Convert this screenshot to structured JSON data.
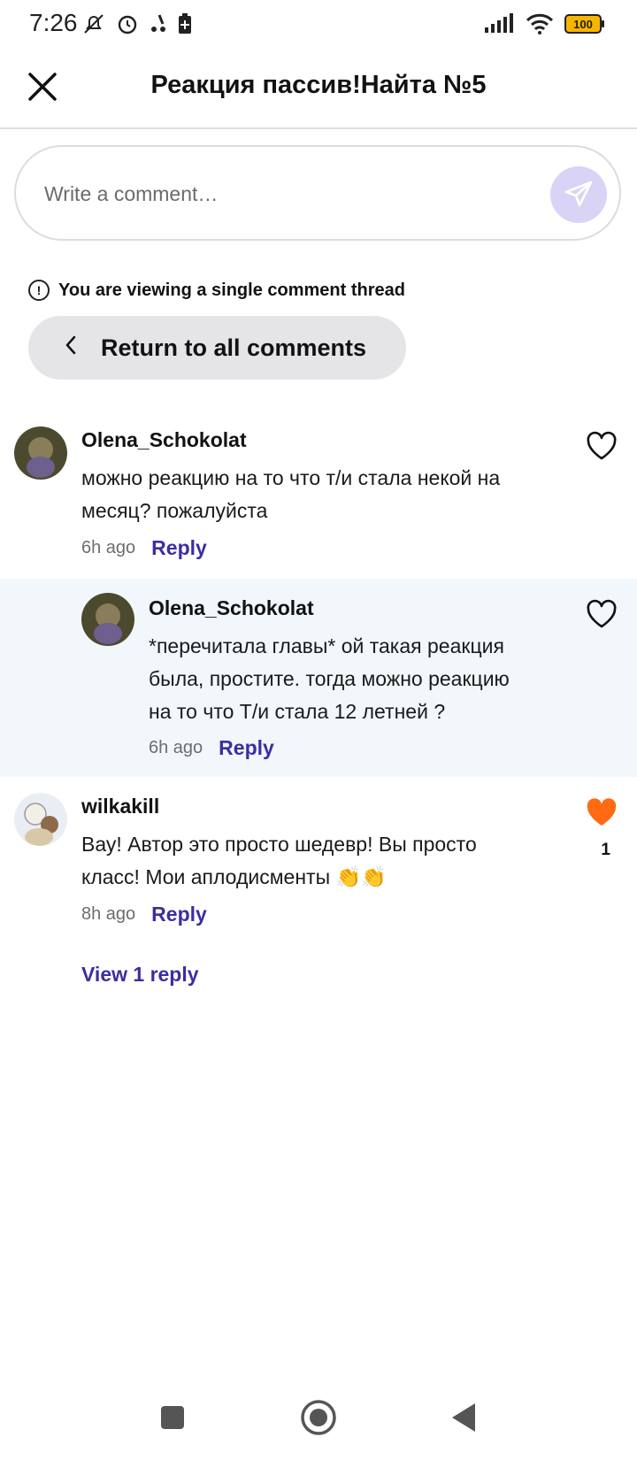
{
  "status_bar": {
    "time": "7:26",
    "battery": "100"
  },
  "header": {
    "title": "Реакция пассив!Найта №5"
  },
  "composer": {
    "placeholder": "Write a comment…"
  },
  "thread": {
    "notice": "You are viewing a single comment thread",
    "return_label": "Return to all comments"
  },
  "comments": [
    {
      "username": "Olena_Schokolat",
      "text_lines": [
        "можно реакцию на то что т/и стала некой на",
        "месяц? пожалуйста"
      ],
      "time": "6h ago",
      "reply": "Reply"
    },
    {
      "username": "Olena_Schokolat",
      "text_lines": [
        "*перечитала главы* ой такая реакция",
        "была, простите. тогда можно реакцию",
        "на то что Т/и стала 12 летней ?"
      ],
      "time": "6h ago",
      "reply": "Reply"
    },
    {
      "username": "wilkakill",
      "text_lines": [
        "Вау! Автор это просто шедевр! Вы просто",
        "класс! Мои аплодисменты 👏👏"
      ],
      "time": "8h ago",
      "reply": "Reply",
      "likes": "1"
    }
  ],
  "view_replies": "View 1 reply",
  "colors": {
    "accent": "#3b2ea1",
    "liked": "#ff6a13",
    "highlight_bg": "#f1f7fb",
    "send_bg": "#d9d4f5"
  },
  "icons": [
    "close-icon",
    "send-icon",
    "info-icon",
    "chevron-left-icon",
    "heart-outline-icon",
    "heart-filled-icon",
    "wifi-icon",
    "signal-icon"
  ]
}
